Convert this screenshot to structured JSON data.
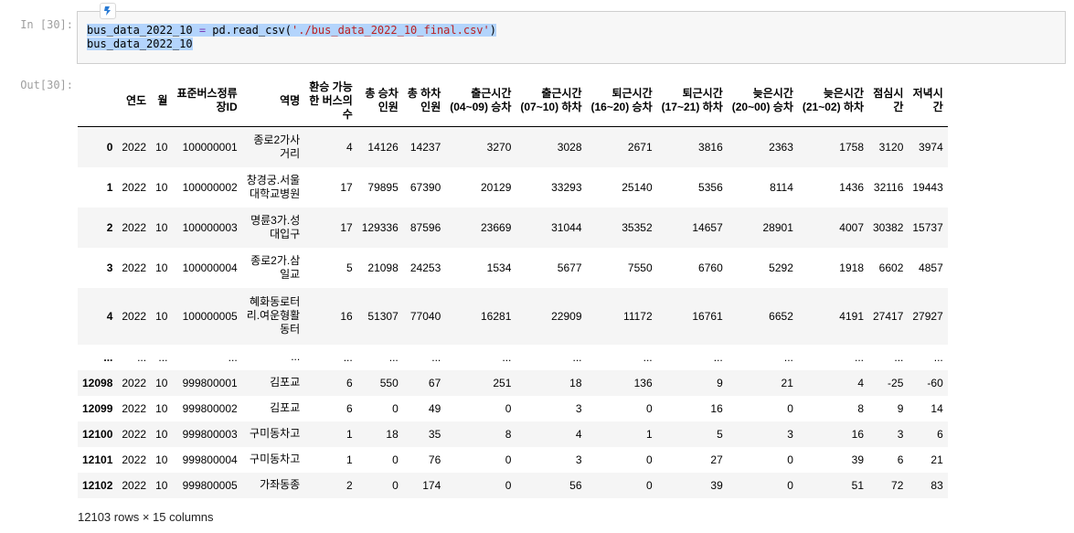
{
  "cell": {
    "in_prompt": "In [30]:",
    "out_prompt": "Out[30]:",
    "code": {
      "line1_var": "bus_data_2022_10",
      "line1_eq": "=",
      "line1_call": "pd.read_csv(",
      "line1_str": "'./bus_data_2022_10_final.csv'",
      "line1_close": ")",
      "line2": "bus_data_2022_10"
    }
  },
  "table": {
    "columns": [
      "",
      "연도",
      "월",
      "표준버스정류\n장ID",
      "역명",
      "환승 가능\n한 버스의\n수",
      "총 승차\n인원",
      "총 하차\n인원",
      "출근시간\n(04~09) 승차",
      "출근시간\n(07~10) 하차",
      "퇴근시간\n(16~20) 승차",
      "퇴근시간\n(17~21) 하차",
      "늦은시간\n(20~00) 승차",
      "늦은시간\n(21~02) 하차",
      "점심시\n간",
      "저녁시\n간"
    ],
    "rows": [
      [
        "0",
        "2022",
        "10",
        "100000001",
        "종로2가사\n거리",
        "4",
        "14126",
        "14237",
        "3270",
        "3028",
        "2671",
        "3816",
        "2363",
        "1758",
        "3120",
        "3974"
      ],
      [
        "1",
        "2022",
        "10",
        "100000002",
        "창경궁.서울\n대학교병원",
        "17",
        "79895",
        "67390",
        "20129",
        "33293",
        "25140",
        "5356",
        "8114",
        "1436",
        "32116",
        "19443"
      ],
      [
        "2",
        "2022",
        "10",
        "100000003",
        "명륜3가.성\n대입구",
        "17",
        "129336",
        "87596",
        "23669",
        "31044",
        "35352",
        "14657",
        "28901",
        "4007",
        "30382",
        "15737"
      ],
      [
        "3",
        "2022",
        "10",
        "100000004",
        "종로2가.삼\n일교",
        "5",
        "21098",
        "24253",
        "1534",
        "5677",
        "7550",
        "6760",
        "5292",
        "1918",
        "6602",
        "4857"
      ],
      [
        "4",
        "2022",
        "10",
        "100000005",
        "혜화동로터\n리.여운형활\n동터",
        "16",
        "51307",
        "77040",
        "16281",
        "22909",
        "11172",
        "16761",
        "6652",
        "4191",
        "27417",
        "27927"
      ],
      [
        "...",
        "...",
        "...",
        "...",
        "...",
        "...",
        "...",
        "...",
        "...",
        "...",
        "...",
        "...",
        "...",
        "...",
        "...",
        "..."
      ],
      [
        "12098",
        "2022",
        "10",
        "999800001",
        "김포교",
        "6",
        "550",
        "67",
        "251",
        "18",
        "136",
        "9",
        "21",
        "4",
        "-25",
        "-60"
      ],
      [
        "12099",
        "2022",
        "10",
        "999800002",
        "김포교",
        "6",
        "0",
        "49",
        "0",
        "3",
        "0",
        "16",
        "0",
        "8",
        "9",
        "14"
      ],
      [
        "12100",
        "2022",
        "10",
        "999800003",
        "구미동차고",
        "1",
        "18",
        "35",
        "8",
        "4",
        "1",
        "5",
        "3",
        "16",
        "3",
        "6"
      ],
      [
        "12101",
        "2022",
        "10",
        "999800004",
        "구미동차고",
        "1",
        "0",
        "76",
        "0",
        "3",
        "0",
        "27",
        "0",
        "39",
        "6",
        "21"
      ],
      [
        "12102",
        "2022",
        "10",
        "999800005",
        "가좌동종",
        "2",
        "0",
        "174",
        "0",
        "56",
        "0",
        "39",
        "0",
        "51",
        "72",
        "83"
      ]
    ]
  },
  "footer": {
    "row_count": "12103 rows × 15 columns"
  },
  "colors": {
    "selection": "#b3d4fc",
    "input_bg": "#f7f7f7",
    "stripe": "#f5f5f5",
    "prompt": "#9e9e9e"
  },
  "icons": {
    "kernel_badge": "notebook-kernel-icon"
  }
}
